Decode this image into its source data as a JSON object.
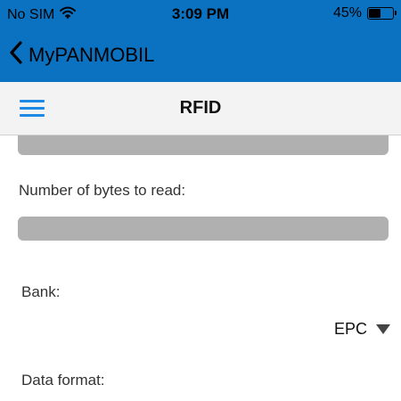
{
  "status_bar": {
    "carrier": "No SIM",
    "time": "3:09 PM",
    "battery": "45%",
    "battery_level": 0.45,
    "wifi_icon": "wifi-icon"
  },
  "nav": {
    "back_label": "MyPANMOBIL",
    "back_icon": "chevron-left-icon"
  },
  "toolbar": {
    "title": "RFID",
    "menu_icon": "hamburger-menu-icon"
  },
  "form": {
    "bytes_label": "Number of bytes to read:",
    "bank_label": "Bank:",
    "bank_value": "EPC",
    "format_label": "Data format:"
  },
  "colors": {
    "header_blue": "#0b72c2",
    "accent": "#1e88e5",
    "field_gray": "#b0b0b0"
  }
}
